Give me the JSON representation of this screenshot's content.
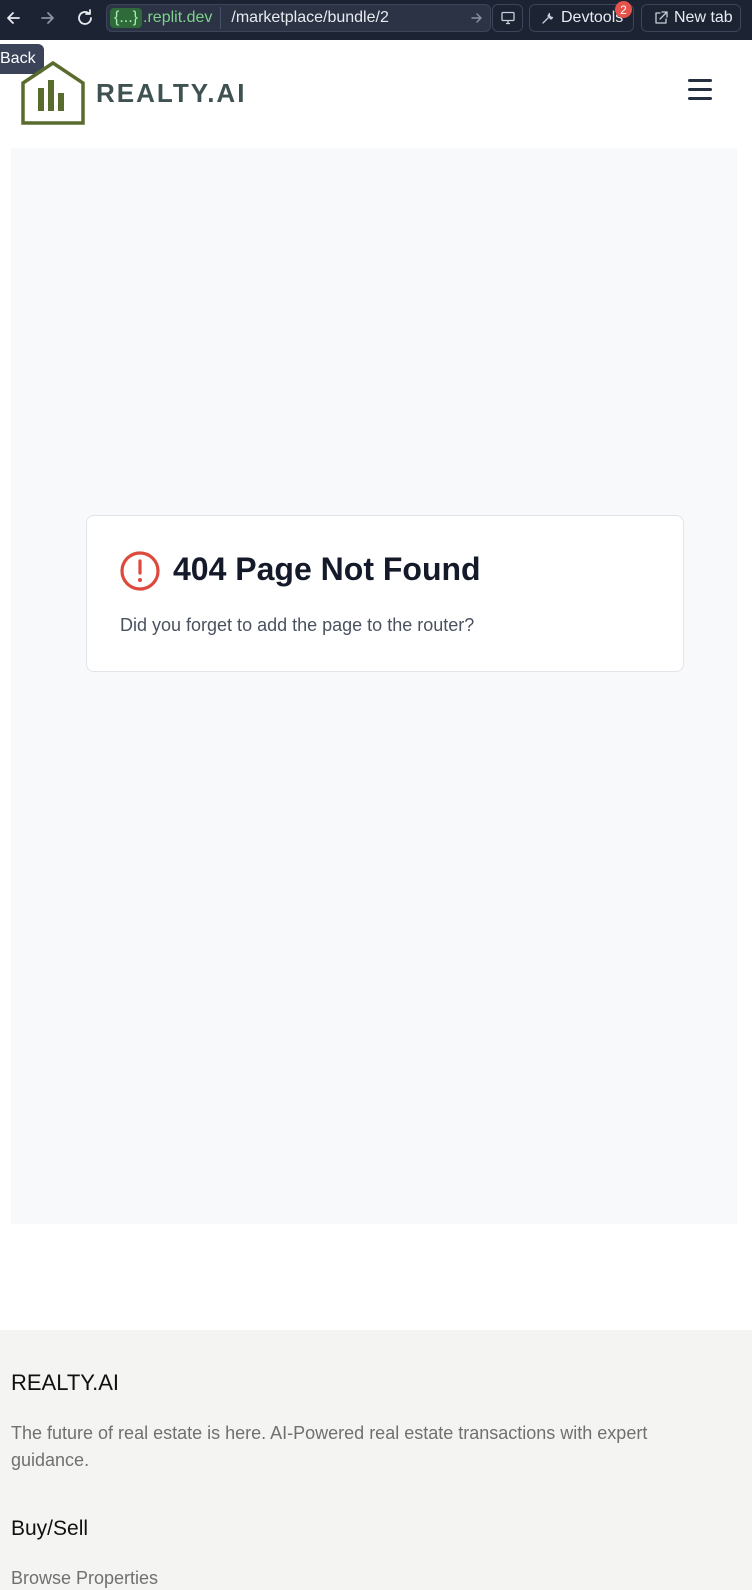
{
  "browser": {
    "domain_prefix": "{...}",
    "domain_suffix": ".replit.dev",
    "path": "/marketplace/bundle/2",
    "devtools_label": "Devtools",
    "devtools_badge": "2",
    "new_tab_label": "New tab",
    "back_tooltip": "Back"
  },
  "header": {
    "logo_text": "REALTY.AI"
  },
  "error_card": {
    "title": "404 Page Not Found",
    "message": "Did you forget to add the page to the router?"
  },
  "footer": {
    "brand": "REALTY.AI",
    "tagline": "The future of real estate is here. AI-Powered real estate transactions with expert guidance.",
    "section_heading": "Buy/Sell",
    "links": [
      "Browse Properties"
    ]
  },
  "colors": {
    "toolbar_bg": "#1c2333",
    "logo_green": "#5a6b2e",
    "logo_text": "#3f5151",
    "alert_red": "#dc4a3d",
    "footer_bg": "#f4f4f3"
  }
}
